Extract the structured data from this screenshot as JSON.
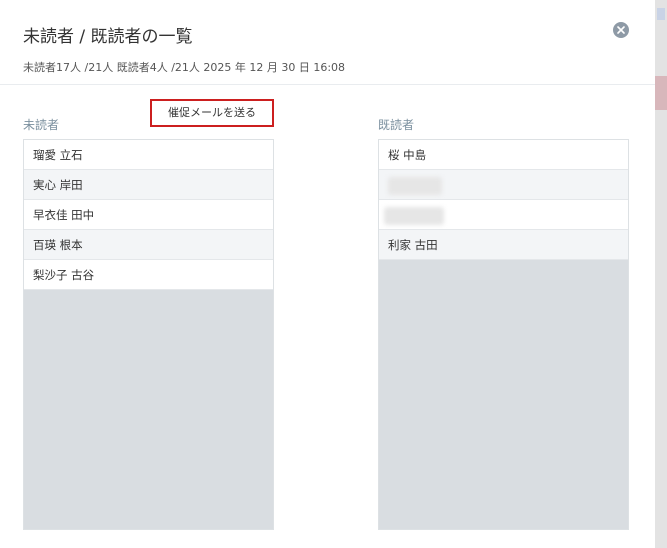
{
  "modal": {
    "title": "未読者 / 既読者の一覧",
    "summary": "未読者17人 /21人  既読者4人 /21人  2025 年 12 月 30 日 16:08",
    "close_icon": "close-circle-icon"
  },
  "unread": {
    "label": "未読者",
    "remind_button": "催促メールを送る",
    "names": [
      "瑠愛 立石",
      "実心 岸田",
      "早衣佳 田中",
      "百瑛 根本",
      "梨沙子 古谷"
    ]
  },
  "read": {
    "label": "既読者",
    "names": [
      "桜 中島",
      "",
      "",
      "利家 古田"
    ]
  },
  "colors": {
    "accent_border": "#cc1f1f",
    "label": "#7a8f9e",
    "list_empty_bg": "#d9dde1",
    "close_bg": "#8e9aa6"
  }
}
